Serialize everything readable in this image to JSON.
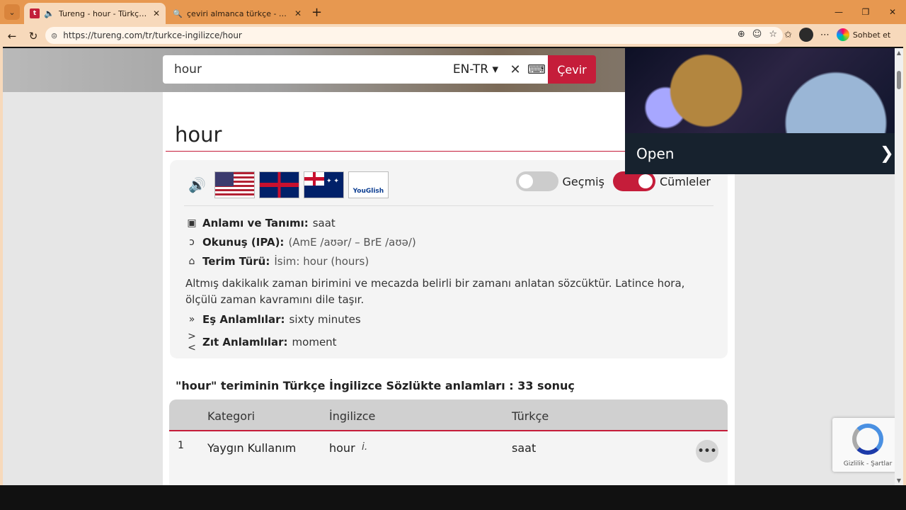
{
  "browser": {
    "tabs": [
      {
        "title": "Tureng - hour - Türkçe İngilizce Sözlük",
        "active": true,
        "favicon": "tureng-icon",
        "audio": true
      },
      {
        "title": "çeviri almanca türkçe - Arama",
        "active": false,
        "favicon": "search-icon"
      }
    ],
    "new_tab_glyph": "+",
    "url": "https://tureng.com/tr/turkce-ingilizce/hour",
    "copilot_label": "Sohbet et",
    "theme_color": "#e79850"
  },
  "search": {
    "query": "hour",
    "language": "EN-TR",
    "button_label": "Çevir",
    "accent": "#c51d3a"
  },
  "entry": {
    "word": "hour",
    "toggles": {
      "history_label": "Geçmiş",
      "history_on": false,
      "sentences_label": "Cümleler",
      "sentences_on": true
    },
    "youglish_label": "YouGlish",
    "meaning_label": "Anlamı ve Tanımı:",
    "meaning_value": "saat",
    "ipa_label": "Okunuş (IPA):",
    "ipa_value": "(AmE /aʊər/ – BrE /aʊə/)",
    "type_label": "Terim Türü:",
    "type_value": "İsim: hour (hours)",
    "description": "Altmış dakikalık zaman birimini ve mecazda belirli bir zamanı anlatan sözcüktür. Latince hora, ölçülü zaman kavramını dile taşır.",
    "synonyms_label": "Eş Anlamlılar:",
    "synonyms_value": "sixty minutes",
    "antonyms_label": "Zıt Anlamlılar:",
    "antonyms_value": "moment"
  },
  "results": {
    "heading": "\"hour\" teriminin Türkçe İngilizce Sözlükte anlamları : 33 sonuç",
    "columns": [
      "Kategori",
      "İngilizce",
      "Türkçe"
    ],
    "rows": [
      {
        "num": "1",
        "category": "Yaygın Kullanım",
        "english": "hour",
        "pos": "i.",
        "turkish": "saat"
      }
    ]
  },
  "ad": {
    "button_label": "Open"
  },
  "recaptcha": {
    "links": "Gizlilik - Şartlar"
  }
}
